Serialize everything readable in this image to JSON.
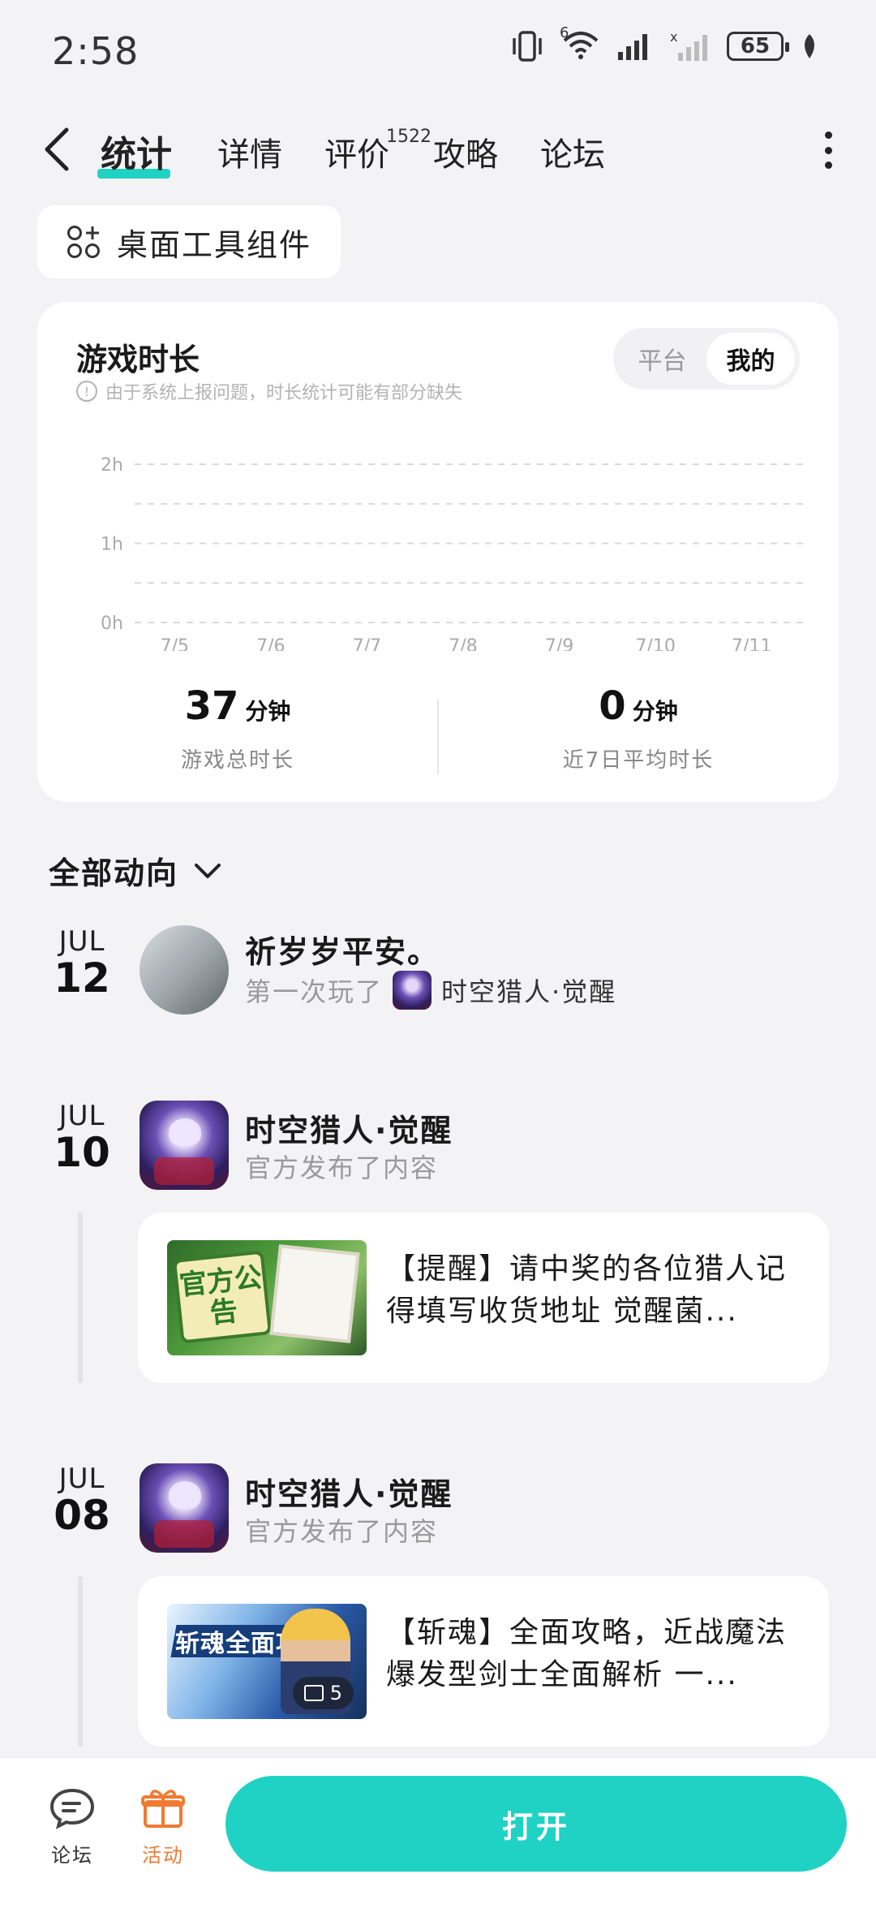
{
  "status_bar": {
    "time": "2:58",
    "network": "6",
    "battery": "65"
  },
  "nav": {
    "tabs": [
      {
        "label": "统计",
        "active": true
      },
      {
        "label": "详情"
      },
      {
        "label": "评价",
        "badge": "1522"
      },
      {
        "label": "攻略"
      },
      {
        "label": "论坛"
      }
    ]
  },
  "widget_chip": {
    "label": "桌面工具组件"
  },
  "stats": {
    "title": "游戏时长",
    "note": "由于系统上报问题，时长统计可能有部分缺失",
    "segments": [
      {
        "label": "平台",
        "active": false
      },
      {
        "label": "我的",
        "active": true
      }
    ],
    "total_value": "37",
    "total_unit": "分钟",
    "total_label": "游戏总时长",
    "avg_value": "0",
    "avg_unit": "分钟",
    "avg_label": "近7日平均时长"
  },
  "chart_data": {
    "type": "bar",
    "categories": [
      "7/5",
      "7/6",
      "7/7",
      "7/8",
      "7/9",
      "7/10",
      "7/11"
    ],
    "values": [
      0,
      0,
      0,
      0,
      0,
      0,
      0
    ],
    "y_ticks": [
      "0h",
      "1h",
      "2h"
    ],
    "ylim": [
      0,
      2
    ],
    "grid": true
  },
  "filter": {
    "label": "全部动向"
  },
  "feed": [
    {
      "month": "JUL",
      "day": "12",
      "name": "祈岁岁平安。",
      "sub": "第一次玩了",
      "game_ref": "时空猎人·觉醒"
    },
    {
      "month": "JUL",
      "day": "10",
      "name": "时空猎人·觉醒",
      "sub": "官方发布了内容",
      "thumb_text": "官方公告",
      "post_title": "【提醒】请中奖的各位猎人记得填写收货地址 觉醒菌..."
    },
    {
      "month": "JUL",
      "day": "08",
      "name": "时空猎人·觉醒",
      "sub": "官方发布了内容",
      "thumb_text": "斩魂全面攻略",
      "img_count": "5",
      "post_title": "【斩魂】全面攻略，近战魔法爆发型剑士全面解析 一..."
    }
  ],
  "bottom_bar": {
    "forum_label": "论坛",
    "activity_label": "活动",
    "open_label": "打开"
  }
}
